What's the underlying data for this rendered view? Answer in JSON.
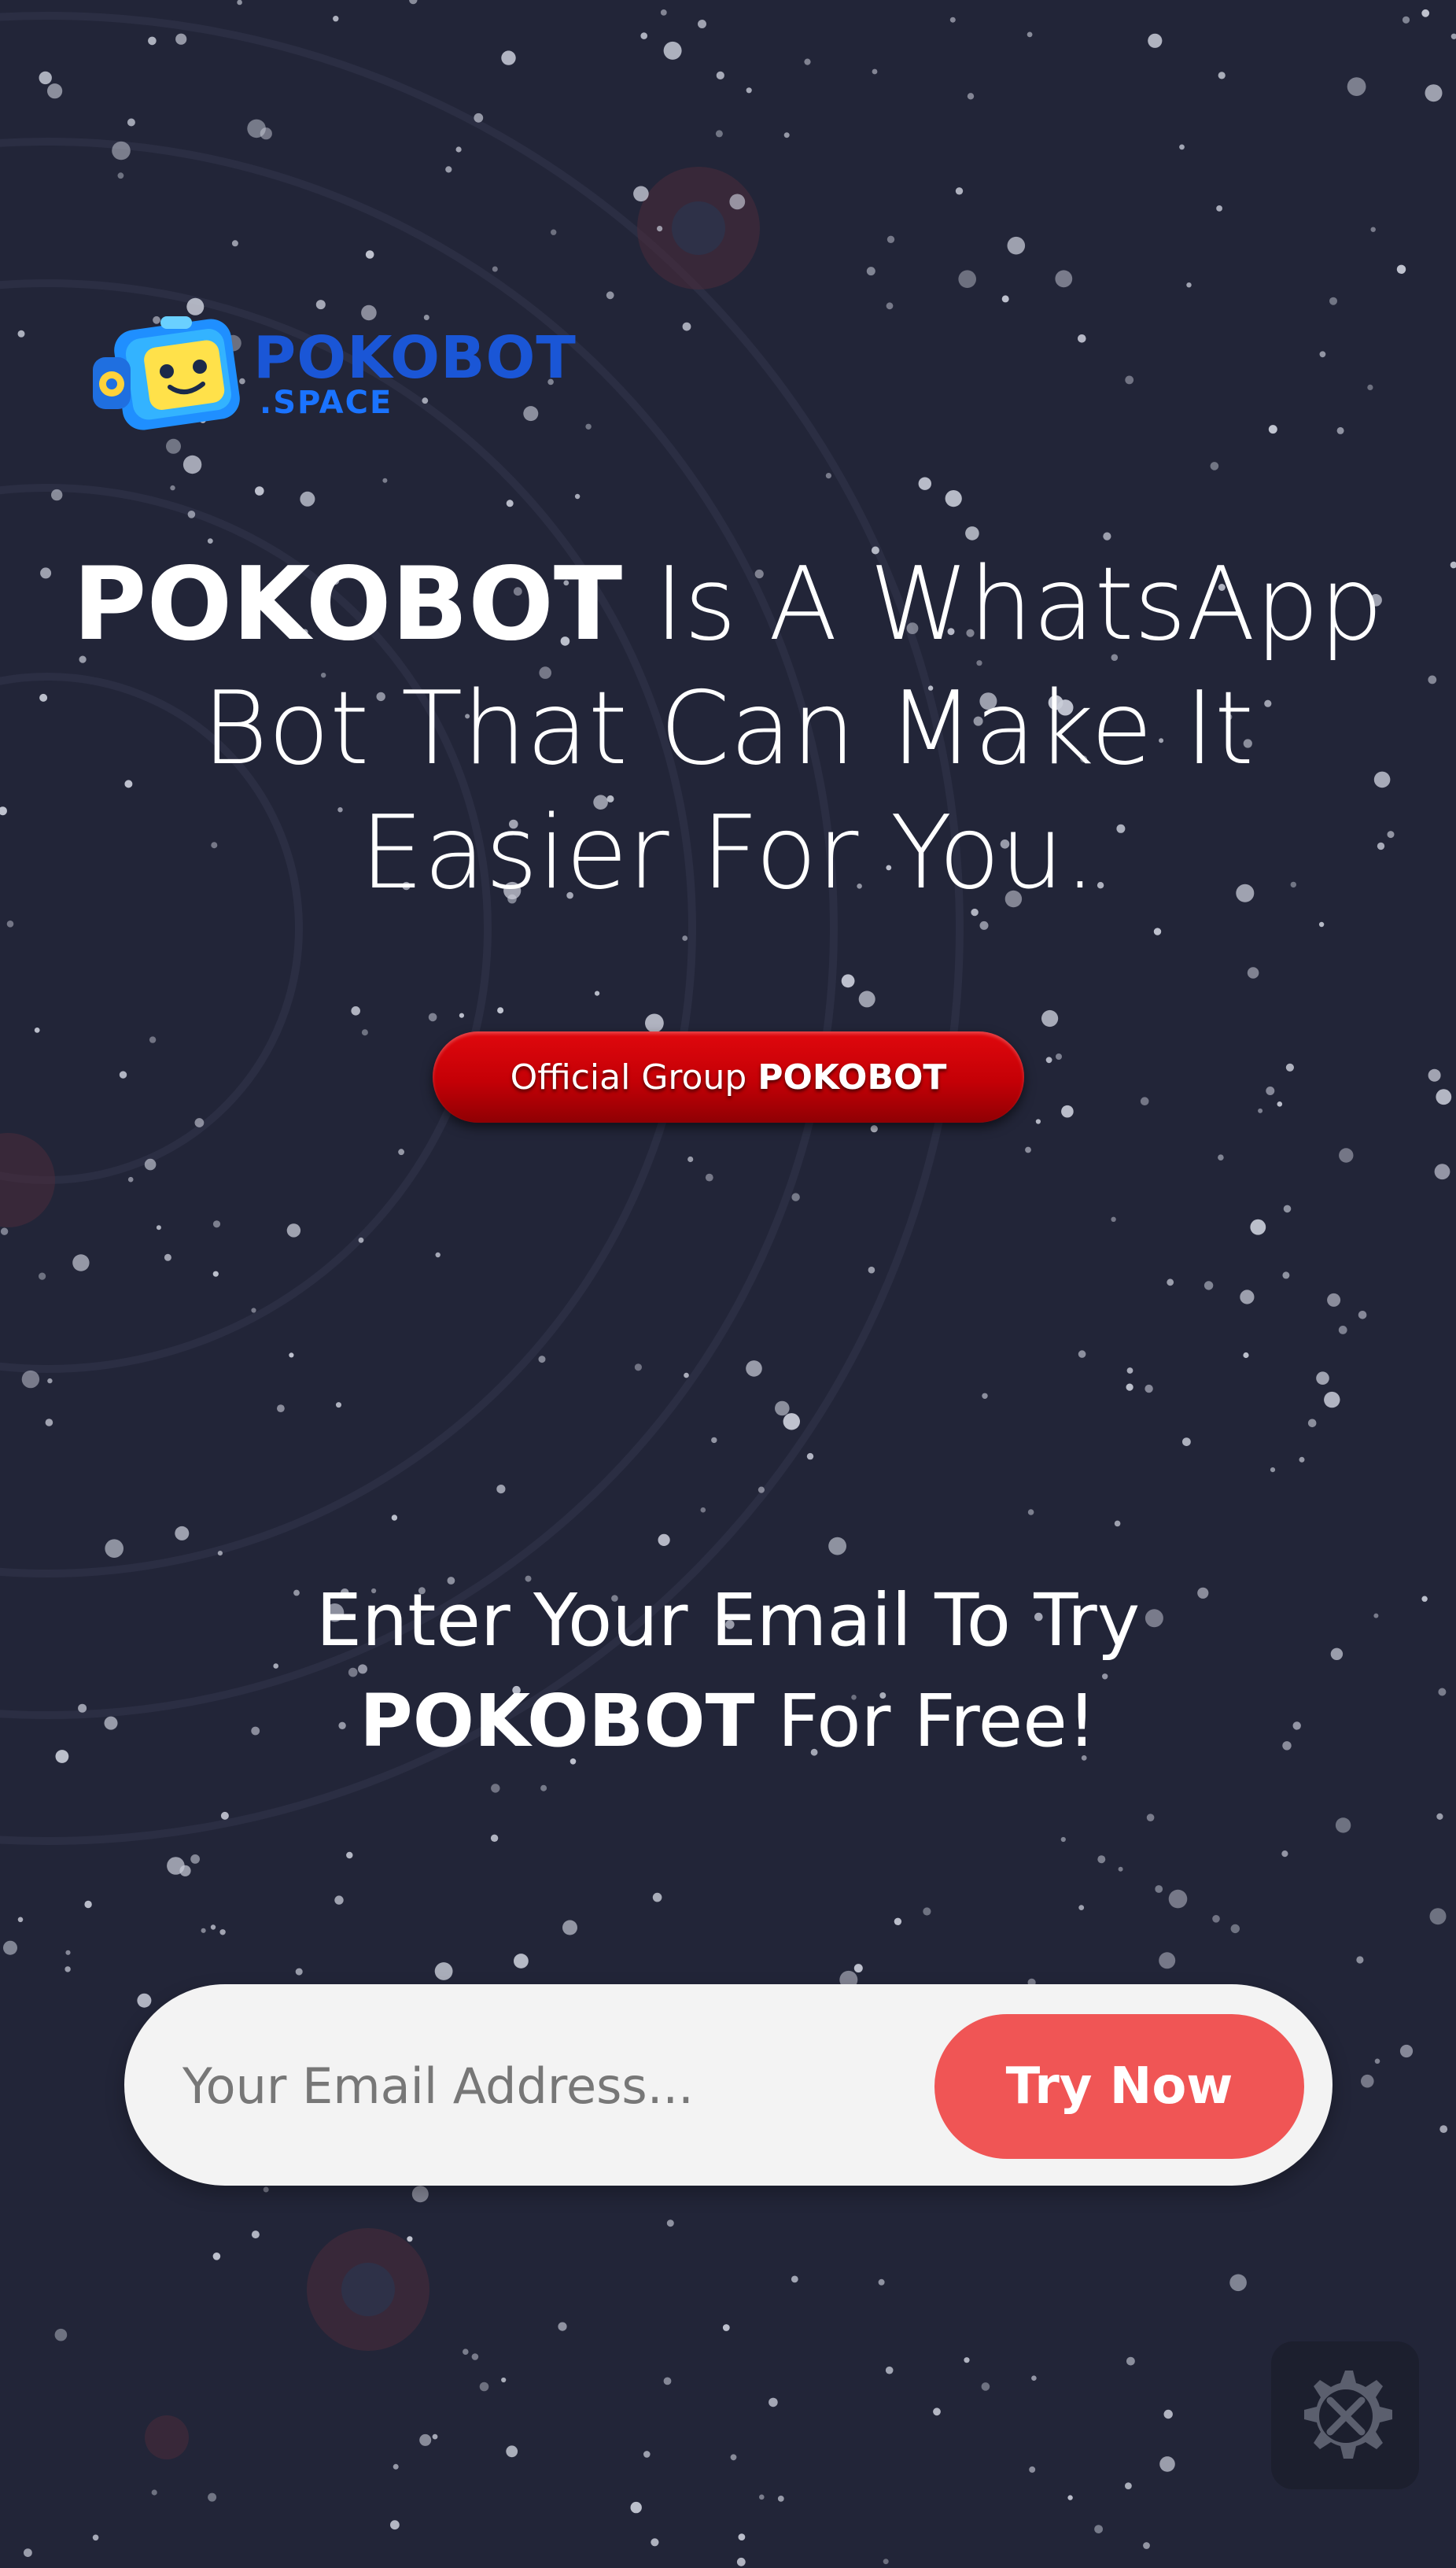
{
  "logo": {
    "name": "POKOBOT",
    "sub": ".SPACE"
  },
  "headline": {
    "brand": "POKOBOT",
    "line1_rest": " Is A WhatsApp",
    "line2": "Bot That Can Make It",
    "line3": "Easier For You."
  },
  "group_button": {
    "prefix": "Official Group",
    "brand": "POKOBOT"
  },
  "subheading": {
    "line1": "Enter Your Email To Try",
    "brand": "POKOBOT",
    "line2_rest": " For Free!"
  },
  "email_form": {
    "placeholder": "Your Email Address...",
    "value": "",
    "button_label": "Try Now"
  },
  "colors": {
    "background": "#222538",
    "accent_red": "#c40006",
    "cta": "#f05555",
    "logo_blue": "#1a56d6"
  },
  "icons": {
    "settings": "settings-tools-icon",
    "robot": "robot-logo-icon"
  }
}
